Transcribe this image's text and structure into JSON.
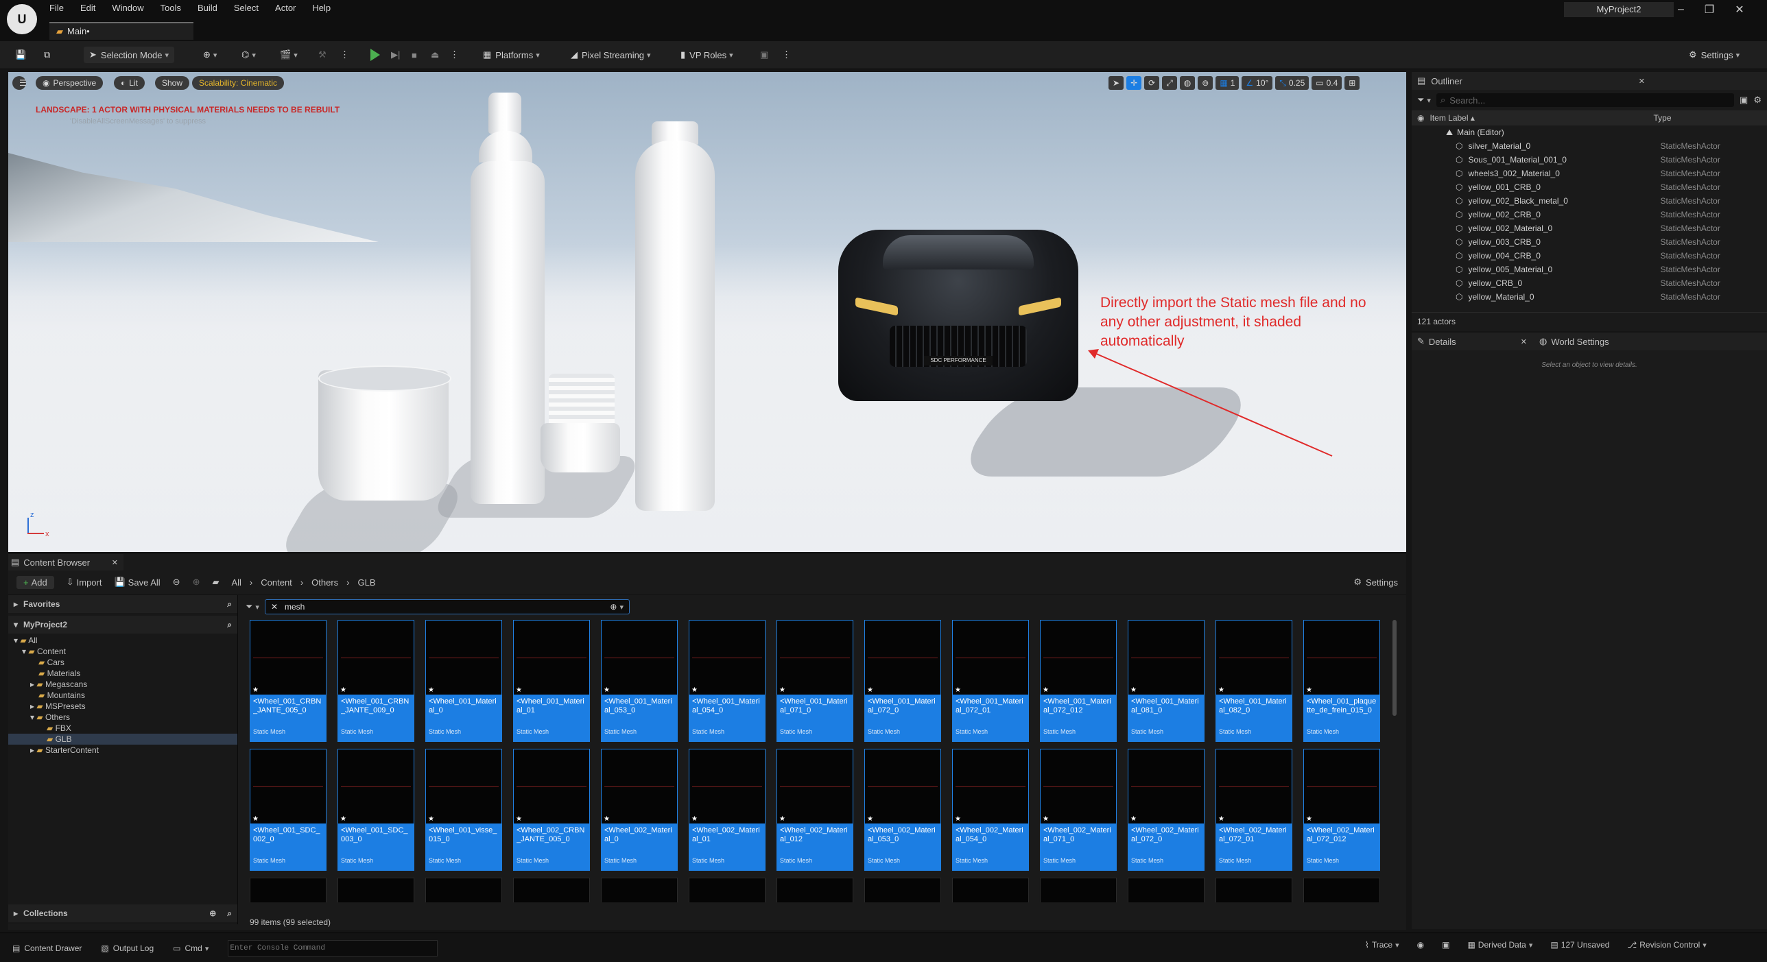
{
  "titlebar": {
    "logo": "U",
    "menu": [
      "File",
      "Edit",
      "Window",
      "Tools",
      "Build",
      "Select",
      "Actor",
      "Help"
    ],
    "tab": "Main•",
    "project": "MyProject2"
  },
  "toolbar": {
    "selection_mode": "Selection Mode",
    "platforms": "Platforms",
    "pixel_streaming": "Pixel Streaming",
    "vp_roles": "VP Roles",
    "settings": "Settings"
  },
  "viewport": {
    "perspective": "Perspective",
    "lit": "Lit",
    "show": "Show",
    "scalability": "Scalability: Cinematic",
    "grid_size": "1",
    "angle": "10°",
    "scale": "0.25",
    "camera_speed": "0.4",
    "warning": "LANDSCAPE: 1 ACTOR WITH PHYSICAL MATERIALS NEEDS TO BE REBUILT",
    "suppress": "'DisableAllScreenMessages' to suppress",
    "annotation": "Directly import the Static mesh file and no any other adjustment, it shaded automatically",
    "axis_z": "z",
    "axis_x": "x",
    "license_plate": "SDC PERFORMANCE"
  },
  "outliner": {
    "title": "Outliner",
    "search_placeholder": "Search...",
    "col_label": "Item Label",
    "col_type": "Type",
    "root": "Main (Editor)",
    "items": [
      {
        "name": "silver_Material_0",
        "type": "StaticMeshActor"
      },
      {
        "name": "Sous_001_Material_001_0",
        "type": "StaticMeshActor"
      },
      {
        "name": "wheels3_002_Material_0",
        "type": "StaticMeshActor"
      },
      {
        "name": "yellow_001_CRB_0",
        "type": "StaticMeshActor"
      },
      {
        "name": "yellow_002_Black_metal_0",
        "type": "StaticMeshActor"
      },
      {
        "name": "yellow_002_CRB_0",
        "type": "StaticMeshActor"
      },
      {
        "name": "yellow_002_Material_0",
        "type": "StaticMeshActor"
      },
      {
        "name": "yellow_003_CRB_0",
        "type": "StaticMeshActor"
      },
      {
        "name": "yellow_004_CRB_0",
        "type": "StaticMeshActor"
      },
      {
        "name": "yellow_005_Material_0",
        "type": "StaticMeshActor"
      },
      {
        "name": "yellow_CRB_0",
        "type": "StaticMeshActor"
      },
      {
        "name": "yellow_Material_0",
        "type": "StaticMeshActor"
      }
    ],
    "count": "121 actors"
  },
  "details": {
    "tab_details": "Details",
    "tab_world": "World Settings",
    "empty": "Select an object to view details."
  },
  "content_browser": {
    "title": "Content Browser",
    "add": "Add",
    "import": "Import",
    "save_all": "Save All",
    "breadcrumb": [
      "All",
      "Content",
      "Others",
      "GLB"
    ],
    "settings": "Settings",
    "favorites": "Favorites",
    "project": "MyProject2",
    "tree": [
      "All",
      "Content",
      "Cars",
      "Materials",
      "Megascans",
      "Mountains",
      "MSPresets",
      "Others",
      "FBX",
      "GLB",
      "StarterContent"
    ],
    "collections": "Collections",
    "search_value": "mesh",
    "footer": "99 items (99 selected)",
    "asset_type": "Static Mesh",
    "assets": [
      "<Wheel_001_CRBN_JANTE_005_0",
      "<Wheel_001_CRBN_JANTE_009_0",
      "<Wheel_001_Material_0",
      "<Wheel_001_Material_01",
      "<Wheel_001_Material_053_0",
      "<Wheel_001_Material_054_0",
      "<Wheel_001_Material_071_0",
      "<Wheel_001_Material_072_0",
      "<Wheel_001_Material_072_01",
      "<Wheel_001_Material_072_012",
      "<Wheel_001_Material_081_0",
      "<Wheel_001_Material_082_0",
      "<Wheel_001_plaquette_de_frein_015_0",
      "<Wheel_001_SDC_002_0",
      "<Wheel_001_SDC_003_0",
      "<Wheel_001_visse_015_0",
      "<Wheel_002_CRBN_JANTE_005_0",
      "<Wheel_002_Material_0",
      "<Wheel_002_Material_01",
      "<Wheel_002_Material_012",
      "<Wheel_002_Material_053_0",
      "<Wheel_002_Material_054_0",
      "<Wheel_002_Material_071_0",
      "<Wheel_002_Material_072_0",
      "<Wheel_002_Material_072_01",
      "<Wheel_002_Material_072_012"
    ]
  },
  "statusbar": {
    "content_drawer": "Content Drawer",
    "output_log": "Output Log",
    "cmd": "Cmd",
    "console_placeholder": "Enter Console Command",
    "trace": "Trace",
    "derived_data": "Derived Data",
    "unsaved": "127 Unsaved",
    "revision_control": "Revision Control"
  },
  "colors": {
    "accent": "#1c7ee3",
    "annotation": "#e02a2a",
    "scalability": "#e4b52b"
  }
}
